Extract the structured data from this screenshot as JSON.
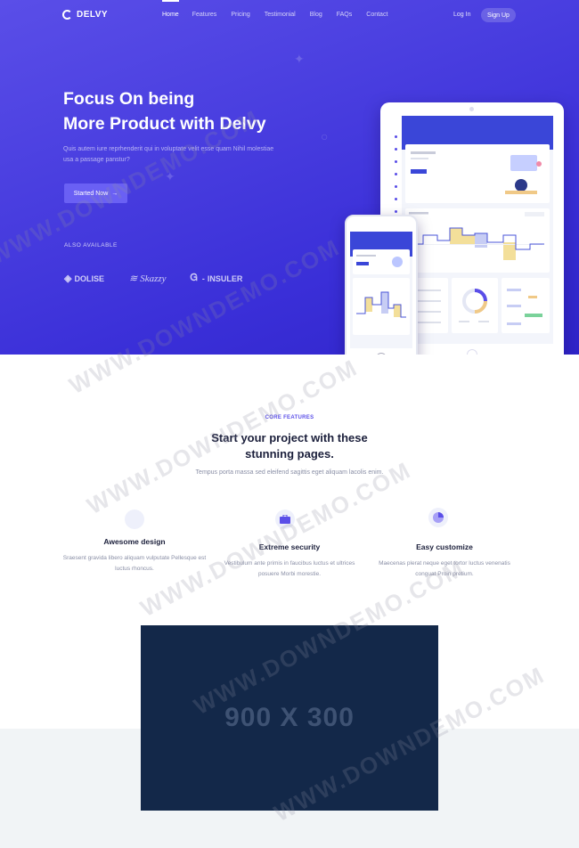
{
  "brand": {
    "name": "DELVY"
  },
  "nav": {
    "items": [
      "Home",
      "Features",
      "Pricing",
      "Testimonial",
      "Blog",
      "FAQs",
      "Contact"
    ],
    "login": "Log In",
    "signup": "Sign Up"
  },
  "hero": {
    "title_line1": "Focus On being",
    "title_line2": "More Product with Delvy",
    "subtitle": "Quis autem iure reprhenderit qui in voluptate velit esse quam Nihil molestiae usa a passage panstur?",
    "cta": "Started Now",
    "also_available": "ALSO AVAILABLE",
    "brands": [
      "DOLISE",
      "Skazzy",
      "INSULER"
    ]
  },
  "features": {
    "kicker": "CORE FEATURES",
    "title": "Start your project with these stunning pages.",
    "subtitle": "Tempus porta massa sed eleifend sagittis eget aliquam lacolis enim.",
    "items": [
      {
        "title": "Awesome design",
        "desc": "Sraesent gravida libero aliquam vulputate Pellesque est luctus rhoncus.",
        "icon": "palette-icon"
      },
      {
        "title": "Extreme security",
        "desc": "Vestibulum ante primis in faucibus luctus et ultrices posuere Morbi morestie.",
        "icon": "briefcase-icon"
      },
      {
        "title": "Easy customize",
        "desc": "Maecenas plerat neque eget tortor luctus venenatis conguat Proin pretium.",
        "icon": "pie-chart-icon"
      }
    ]
  },
  "placeholder": {
    "label": "900 X 300"
  },
  "watermark": "WWW.DOWNDEMO.COM",
  "colors": {
    "primary": "#5a4ee8",
    "hero_dark": "#2f24c9",
    "placeholder_bg": "#132849"
  }
}
